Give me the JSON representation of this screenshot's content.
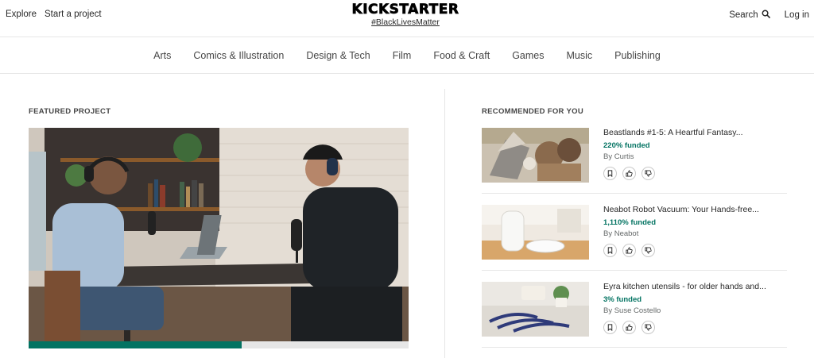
{
  "header": {
    "explore": "Explore",
    "start_project": "Start a project",
    "logo": "KICKSTARTER",
    "tagline": "#BlackLivesMatter",
    "search": "Search",
    "login": "Log in"
  },
  "nav": {
    "items": [
      "Arts",
      "Comics & Illustration",
      "Design & Tech",
      "Film",
      "Food & Craft",
      "Games",
      "Music",
      "Publishing"
    ]
  },
  "featured": {
    "label": "FEATURED PROJECT",
    "funding_fraction": 0.56
  },
  "recommended": {
    "label": "RECOMMENDED FOR YOU",
    "items": [
      {
        "title": "Beastlands #1-5: A Heartful Fantasy...",
        "funded": "220% funded",
        "by": "By Curtis"
      },
      {
        "title": "Neabot Robot Vacuum: Your Hands-free...",
        "funded": "1,110% funded",
        "by": "By Neabot"
      },
      {
        "title": "Eyra kitchen utensils - for older hands and...",
        "funded": "3% funded",
        "by": "By Suse Costello"
      }
    ]
  },
  "colors": {
    "brand_green": "#037362",
    "text": "#282828",
    "border": "#e6e6e6"
  }
}
